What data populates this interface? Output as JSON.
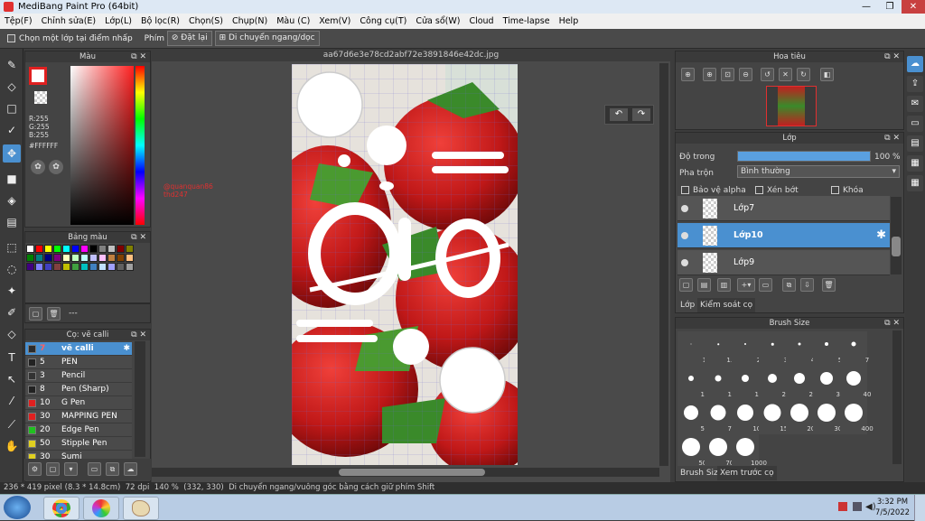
{
  "window": {
    "title": "MediBang Paint Pro (64bit)",
    "minimize": "—",
    "maximize": "❐",
    "close": "✕"
  },
  "menu": [
    "Tệp(F)",
    "Chỉnh sửa(E)",
    "Lớp(L)",
    "Bộ lọc(R)",
    "Chọn(S)",
    "Chụp(N)",
    "Màu (C)",
    "Xem(V)",
    "Công cụ(T)",
    "Cửa sổ(W)",
    "Cloud",
    "Time-lapse",
    "Help"
  ],
  "toolbar": {
    "pick_layer_label": "Chọn một lớp tại điểm nhấp",
    "key_label": "Phím",
    "reset_label": "Đặt lại",
    "move_label": "Di chuyển ngang/dọc"
  },
  "color_panel": {
    "title": "Màu",
    "r": "R:255",
    "g": "G:255",
    "b": "B:255",
    "hex": "#FFFFFF"
  },
  "palette_panel": {
    "title": "Bảng màu",
    "more": "---",
    "swatches": [
      "#ffffff",
      "#ff0000",
      "#ffff00",
      "#00ff00",
      "#00ffff",
      "#0000ff",
      "#ff00ff",
      "#000000",
      "#808080",
      "#c0c0c0",
      "#800000",
      "#808000",
      "#008000",
      "#008080",
      "#000080",
      "#800080",
      "#ffffc0",
      "#c0ffc0",
      "#c0ffff",
      "#c0c0ff",
      "#ffc0ff",
      "#c08040",
      "#804000",
      "#ffc080",
      "#400080",
      "#8080ff",
      "#4040c0",
      "#804040",
      "#c0c000",
      "#40a040",
      "#00c0c0",
      "#4080c0",
      "#c0e0ff",
      "#a0a0ff",
      "#606060",
      "#a0a0a0"
    ]
  },
  "brush_panel": {
    "title": "Cọ: vẽ calli",
    "items": [
      {
        "num": "7",
        "name": "vẽ calli",
        "color": "#2b2b2b",
        "selected": true
      },
      {
        "num": "5",
        "name": "PEN",
        "color": "#222222",
        "selected": false
      },
      {
        "num": "3",
        "name": "Pencil",
        "color": "#333333",
        "selected": false
      },
      {
        "num": "8",
        "name": "Pen (Sharp)",
        "color": "#222222",
        "selected": false
      },
      {
        "num": "10",
        "name": "G Pen",
        "color": "#e02020",
        "selected": false
      },
      {
        "num": "30",
        "name": "MAPPING PEN",
        "color": "#e02020",
        "selected": false
      },
      {
        "num": "20",
        "name": "Edge Pen",
        "color": "#20c020",
        "selected": false
      },
      {
        "num": "50",
        "name": "Stipple Pen",
        "color": "#e0d020",
        "selected": false
      },
      {
        "num": "30",
        "name": "Sumi",
        "color": "#e0d020",
        "selected": false
      }
    ]
  },
  "canvas": {
    "tab_title": "aa67d6e3e78cd2abf72e3891846e42dc.jpg",
    "watermark_1": "@quanquan86",
    "watermark_2": "thd247"
  },
  "navigator": {
    "title": "Hoa tiêu"
  },
  "layer_panel": {
    "title": "Lớp",
    "opacity_label": "Độ trong",
    "opacity_value": "100 %",
    "opacity": 1.0,
    "blend_label": "Pha trộn",
    "blend_value": "Bình thường",
    "protect_alpha": "Bảo vệ alpha",
    "clipping": "Xén bớt",
    "lock": "Khóa",
    "layers": [
      {
        "name": "Lớp7",
        "selected": false
      },
      {
        "name": "Lớp10",
        "selected": true
      },
      {
        "name": "Lớp9",
        "selected": false
      }
    ],
    "tab_layer": "Lớp",
    "tab_brush_control": "Kiểm soát cọ"
  },
  "brush_size_panel": {
    "title": "Brush Size",
    "sizes": [
      "1",
      "1.5",
      "2",
      "3",
      "4",
      "5",
      "7",
      "10",
      "12",
      "15",
      "20",
      "25",
      "30",
      "40",
      "50",
      "70",
      "100",
      "150",
      "200",
      "300",
      "400",
      "500",
      "700",
      "1000"
    ],
    "tab_size": "Brush Size",
    "tab_preview": "Xem trước cọ"
  },
  "status": {
    "dimensions": "236 * 419 pixel",
    "physical": "(8.3 * 14.8cm)",
    "dpi": "72 dpi",
    "zoom": "140 %",
    "coords": "(332, 330)",
    "hint": "Di chuyển ngang/vuông góc bằng cách giữ phím Shift"
  },
  "taskbar": {
    "time": "3:32 PM",
    "date": "7/5/2022"
  }
}
